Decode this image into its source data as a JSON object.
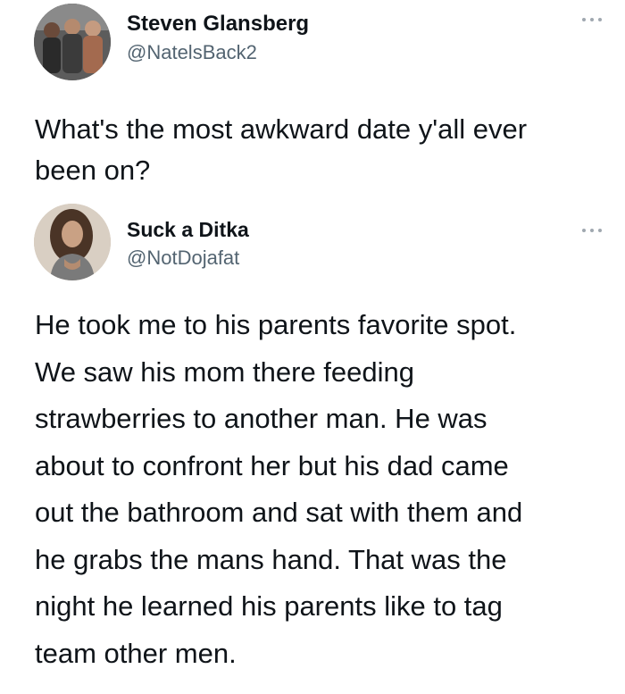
{
  "original_tweet": {
    "author_name": "Steven Glansberg",
    "author_handle": "@NatelsBack2",
    "text": "What's the most awkward date y'all ever\nbeen on?",
    "more_icon": "more-horizontal-icon"
  },
  "reply_tweet": {
    "author_name": "Suck a Ditka",
    "author_handle": "@NotDojafat",
    "text": "He took me to his parents favorite spot.\nWe saw his mom there feeding\nstrawberries to another man. He was\nabout to confront her but his dad came\nout the bathroom and sat with them and\nhe grabs the mans hand. That was the\nnight he learned his parents like to tag\nteam other men.",
    "more_icon": "more-horizontal-icon"
  },
  "colors": {
    "text": "#0f1419",
    "secondary_text": "#536471",
    "background": "#ffffff",
    "icon": "#a0a8b0"
  }
}
